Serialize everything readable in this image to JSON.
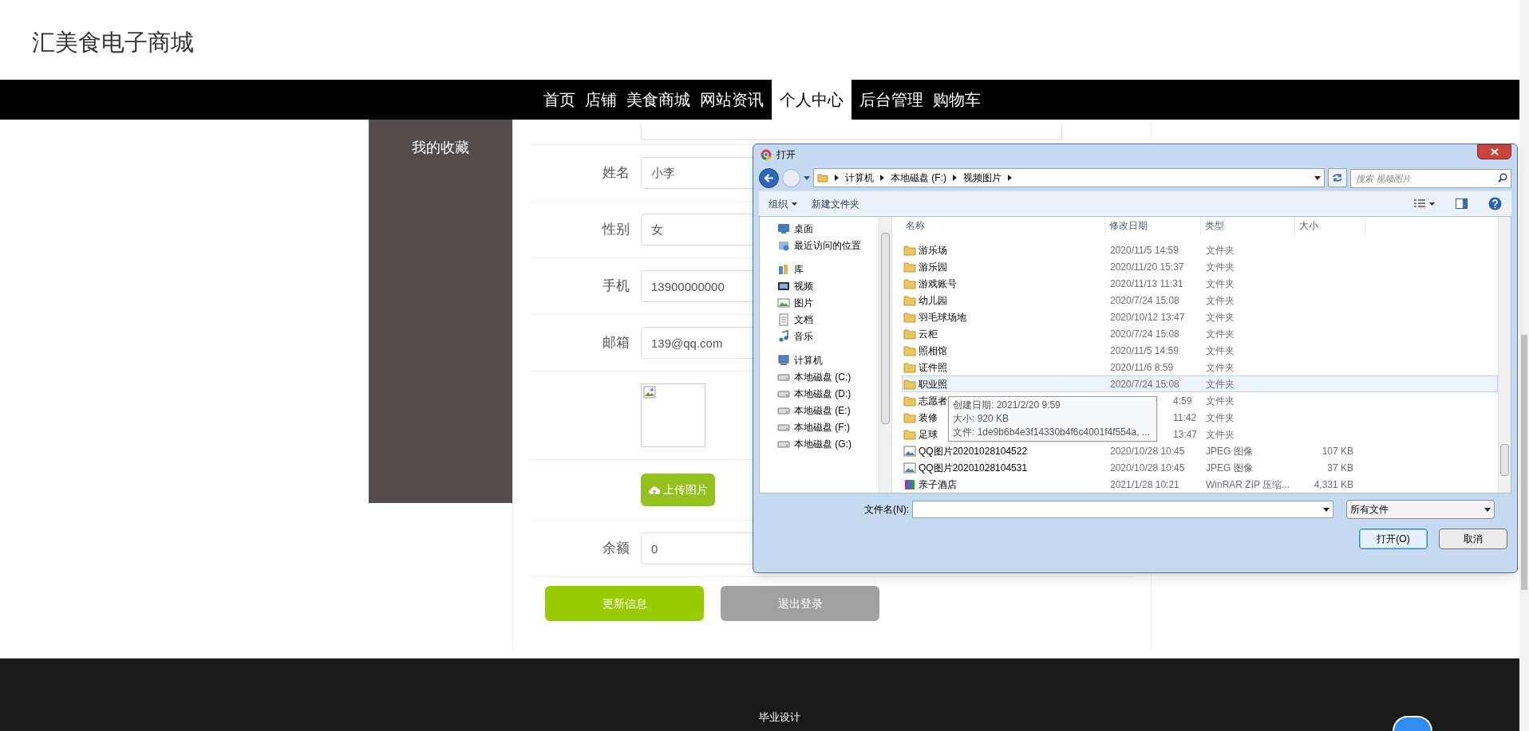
{
  "site": {
    "title": "汇美食电子商城"
  },
  "nav": [
    {
      "label": "首页",
      "selected": false
    },
    {
      "label": "店铺",
      "selected": false
    },
    {
      "label": "美食商城",
      "selected": false
    },
    {
      "label": "网站资讯",
      "selected": false
    },
    {
      "label": "个人中心",
      "selected": true
    },
    {
      "label": "后台管理",
      "selected": false
    },
    {
      "label": "购物车",
      "selected": false
    }
  ],
  "sidebar": {
    "items": [
      {
        "label": "我的收藏"
      }
    ]
  },
  "profile_form": {
    "fields": [
      {
        "kind": "stub"
      },
      {
        "kind": "text",
        "label": "姓名",
        "value": "小李"
      },
      {
        "kind": "text",
        "label": "性别",
        "value": "女"
      },
      {
        "kind": "text",
        "label": "手机",
        "value": "13900000000"
      },
      {
        "kind": "text",
        "label": "邮箱",
        "value": "139@qq.com"
      },
      {
        "kind": "image"
      },
      {
        "kind": "upload",
        "button": "上传图片"
      },
      {
        "kind": "text",
        "label": "余额",
        "value": "0"
      }
    ],
    "buttons": [
      {
        "label": "更新信息",
        "kind": "primary"
      },
      {
        "label": "退出登录",
        "kind": "secondary"
      }
    ]
  },
  "footer": {
    "text": "毕业设计"
  },
  "open_dialog": {
    "title": "打开",
    "breadcrumb": [
      "计算机",
      "本地磁盘 (F:)",
      "视频图片"
    ],
    "search": {
      "placeholder": "搜索 视频图片"
    },
    "toolbar": [
      "组织",
      "新建文件夹"
    ],
    "nav_pane": [
      {
        "label": "桌面",
        "kind": "desktop"
      },
      {
        "label": "最近访问的位置",
        "kind": "recent"
      },
      {
        "label": "库",
        "kind": "library"
      },
      {
        "label": "视频",
        "kind": "video"
      },
      {
        "label": "图片",
        "kind": "picture"
      },
      {
        "label": "文档",
        "kind": "document"
      },
      {
        "label": "音乐",
        "kind": "music"
      },
      {
        "label": "计算机",
        "kind": "computer"
      },
      {
        "label": "本地磁盘 (C:)",
        "kind": "drive"
      },
      {
        "label": "本地磁盘 (D:)",
        "kind": "drive"
      },
      {
        "label": "本地磁盘 (E:)",
        "kind": "drive"
      },
      {
        "label": "本地磁盘 (F:)",
        "kind": "drive"
      },
      {
        "label": "本地磁盘 (G:)",
        "kind": "drive"
      }
    ],
    "columns": [
      "名称",
      "修改日期",
      "类型",
      "大小"
    ],
    "rows": [
      {
        "kind": "folder",
        "name": "游乐场",
        "date": "2020/11/5 14:59",
        "type": "文件夹",
        "selected": false
      },
      {
        "kind": "folder",
        "name": "游乐园",
        "date": "2020/11/20 15:37",
        "type": "文件夹",
        "selected": false
      },
      {
        "kind": "folder",
        "name": "游戏账号",
        "date": "2020/11/13 11:31",
        "type": "文件夹",
        "selected": false
      },
      {
        "kind": "folder",
        "name": "幼儿园",
        "date": "2020/7/24 15:08",
        "type": "文件夹",
        "selected": false
      },
      {
        "kind": "folder",
        "name": "羽毛球场地",
        "date": "2020/10/12 13:47",
        "type": "文件夹",
        "selected": false
      },
      {
        "kind": "folder",
        "name": "云柜",
        "date": "2020/7/24 15:08",
        "type": "文件夹",
        "selected": false
      },
      {
        "kind": "folder",
        "name": "照相馆",
        "date": "2020/11/5 14:59",
        "type": "文件夹",
        "selected": false
      },
      {
        "kind": "folder",
        "name": "证件照",
        "date": "2020/11/6 8:59",
        "type": "文件夹",
        "selected": false
      },
      {
        "kind": "folder",
        "name": "职业照",
        "date": "2020/7/24 15:08",
        "type": "文件夹",
        "selected": true
      },
      {
        "kind": "folder",
        "name": "志愿者",
        "date": "4:59",
        "covered": true,
        "type": "文件夹",
        "selected": false
      },
      {
        "kind": "folder",
        "name": "装修",
        "date": "11:42",
        "covered": true,
        "type": "文件夹",
        "selected": false
      },
      {
        "kind": "folder",
        "name": "足球",
        "date": "13:47",
        "covered": true,
        "type": "文件夹",
        "selected": false
      },
      {
        "kind": "image",
        "name": "QQ图片20201028104522",
        "date": "2020/10/28 10:45",
        "type": "JPEG 图像",
        "size": "107 KB",
        "selected": false
      },
      {
        "kind": "image",
        "name": "QQ图片20201028104531",
        "date": "2020/10/28 10:45",
        "type": "JPEG 图像",
        "size": "37 KB",
        "selected": false
      },
      {
        "kind": "archive",
        "name": "亲子酒店",
        "date": "2021/1/28 10:21",
        "type": "WinRAR ZIP 压缩...",
        "size": "4,331 KB",
        "selected": false
      }
    ],
    "tooltip": [
      "创建日期: 2021/2/20 9:59",
      "大小: 920 KB",
      "文件: 1de9b6b4e3f14330b4f6c4001f4f554a, ..."
    ],
    "filename": {
      "label": "文件名(N):"
    },
    "filter": "所有文件",
    "buttons": [
      {
        "label": "打开(O)",
        "kind": "default"
      },
      {
        "label": "取消",
        "kind": "normal"
      }
    ]
  }
}
